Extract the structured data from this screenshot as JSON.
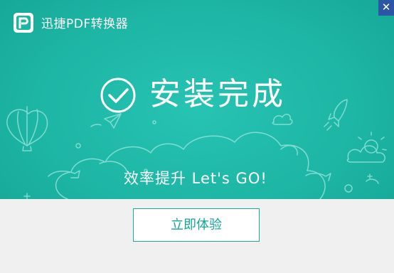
{
  "window": {
    "title": "迅捷PDF转换器",
    "close_symbol": "✕"
  },
  "hero": {
    "status_text": "安装完成",
    "slogan": "效率提升 Let's  GO!"
  },
  "footer": {
    "action_label": "立即体验"
  },
  "colors": {
    "teal_primary": "#1db5a4",
    "close_blue": "#2b56a3",
    "button_text": "#16a595"
  },
  "icons": [
    "app-logo-icon",
    "close-icon",
    "check-circle-icon",
    "hot-air-balloon-icon",
    "paper-plane-icon",
    "rocket-icon",
    "cloud-icon",
    "sun-icon",
    "arrow-icon",
    "sparkle-icon"
  ]
}
